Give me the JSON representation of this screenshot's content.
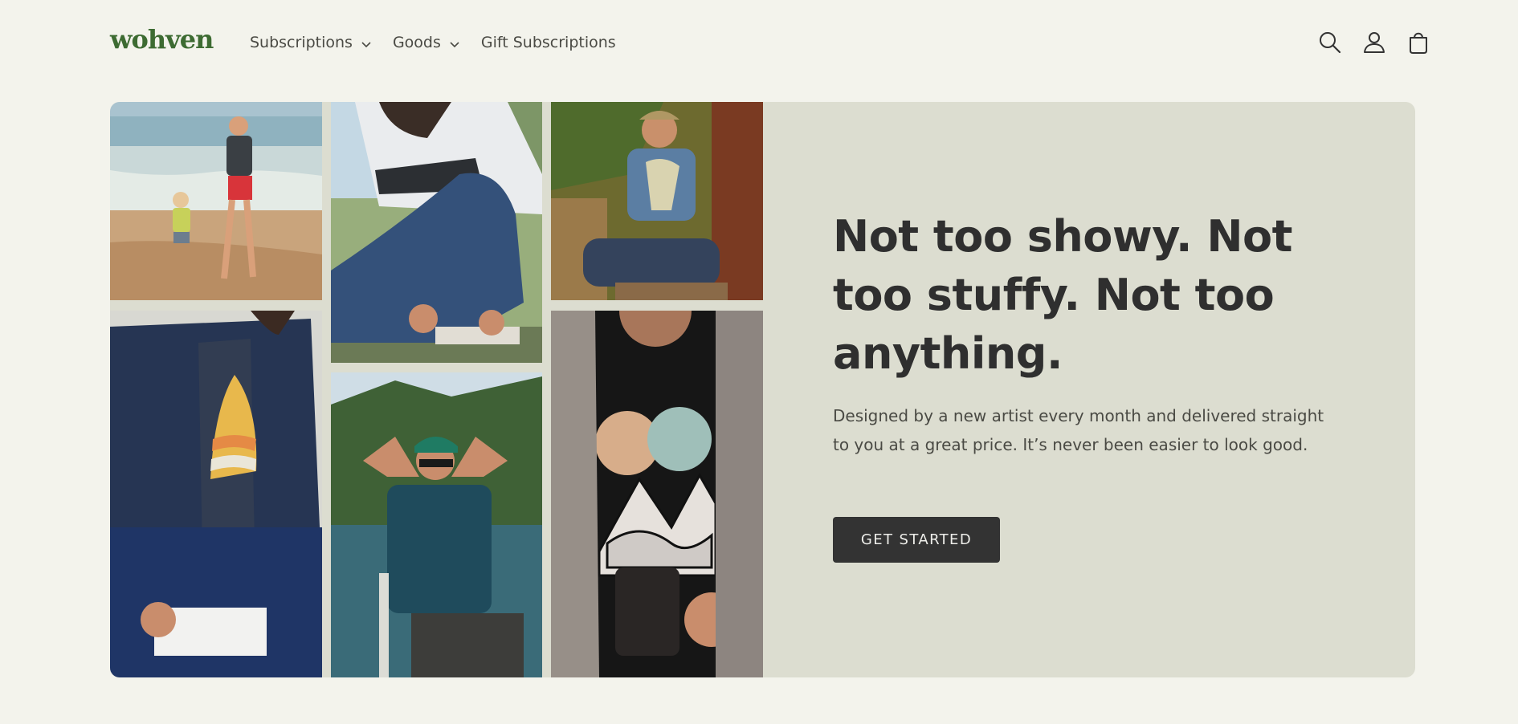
{
  "brand": {
    "logo_text": "wohven",
    "accent_color": "#3d6b32"
  },
  "nav": {
    "items": [
      {
        "label": "Subscriptions",
        "has_dropdown": true
      },
      {
        "label": "Goods",
        "has_dropdown": true
      },
      {
        "label": "Gift Subscriptions",
        "has_dropdown": false
      }
    ]
  },
  "header_icons": [
    "search-icon",
    "account-icon",
    "cart-icon"
  ],
  "hero": {
    "headline": "Not too showy. Not too stuffy. Not too anything.",
    "subtext": "Designed by a new artist every month and delivered straight to you at a great price. It’s never been easier to look good.",
    "cta_label": "GET STARTED",
    "background_color": "#dcddd0",
    "photos": [
      "beach-father-son-photo",
      "man-rolling-jeans-photo",
      "man-seated-log-photo",
      "man-denim-jacket-photo",
      "man-lake-chair-photo",
      "man-holding-mug-photo"
    ]
  }
}
